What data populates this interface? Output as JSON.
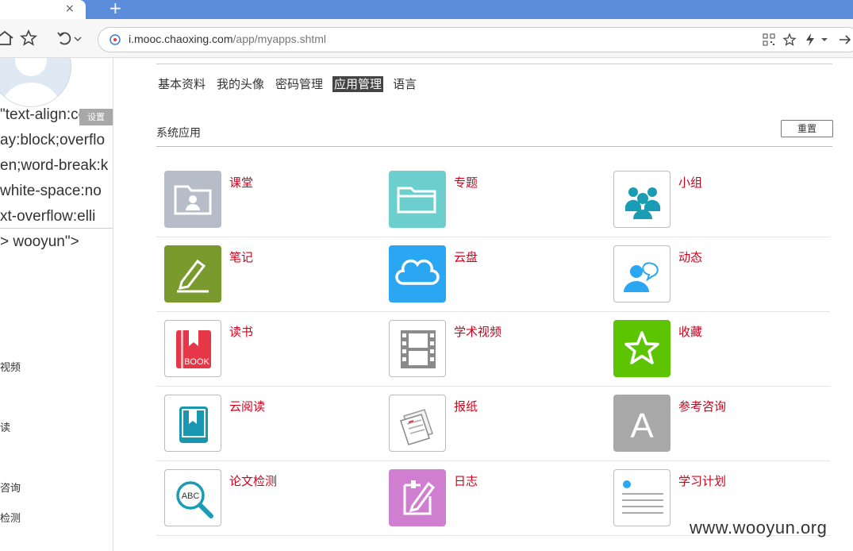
{
  "browser": {
    "tab_close": "×",
    "new_tab": "+",
    "url_host": "i.mooc.chaoxing.com",
    "url_path": "/app/myapps.shtml"
  },
  "left": {
    "set_label": "设置",
    "code_lines": [
      "\"text-align:cent",
      "ay:block;overflo",
      "en;word-break:k",
      "white-space:no",
      "xt-overflow:elli",
      "> wooyun\">"
    ],
    "side_items": [
      "视频",
      "读",
      "咨询",
      "检测"
    ]
  },
  "subnav": [
    "基本资料",
    "我的头像",
    "密码管理",
    "应用管理",
    "语言"
  ],
  "subnav_active": 3,
  "section": {
    "title": "系统应用",
    "reset_label": "重置"
  },
  "apps": [
    [
      {
        "name": "课堂",
        "icon": "classroom-icon"
      },
      {
        "name": "专题",
        "icon": "folder-icon"
      },
      {
        "name": "小组",
        "icon": "group-icon"
      }
    ],
    [
      {
        "name": "笔记",
        "icon": "note-pen-icon"
      },
      {
        "name": "云盘",
        "icon": "cloud-icon"
      },
      {
        "name": "动态",
        "icon": "chat-user-icon"
      }
    ],
    [
      {
        "name": "读书",
        "icon": "book-icon"
      },
      {
        "name": "学术视频",
        "icon": "film-icon"
      },
      {
        "name": "收藏",
        "icon": "star-icon"
      }
    ],
    [
      {
        "name": "云阅读",
        "icon": "ebook-icon"
      },
      {
        "name": "报纸",
        "icon": "newspaper-icon"
      },
      {
        "name": "参考咨询",
        "icon": "letter-a-icon"
      }
    ],
    [
      {
        "name": "论文检测",
        "icon": "abc-search-icon"
      },
      {
        "name": "日志",
        "icon": "diary-icon"
      },
      {
        "name": "学习计划",
        "icon": "plan-list-icon"
      }
    ]
  ],
  "icon_texts": {
    "book": "BOOK",
    "abc": "ABC",
    "letter_a": "A"
  },
  "colors": {
    "app_name": "#d0021b",
    "tabstrip": "#5b8ddb",
    "classroom": "#b6bdc9",
    "folder": "#6ccfce",
    "group": "#1a9cb4",
    "note": "#7a9a2e",
    "cloud": "#2aa6f2",
    "chat": "#2aa6f2",
    "book": "#e53747",
    "film": "#8a8a8a",
    "star": "#5cc400",
    "ebook": "#1a97b0",
    "letter": "#a8a8a8",
    "abc": "#1a9cb4",
    "diary": "#d07fd0",
    "plan": "#2aa6f2"
  },
  "watermark": "www.wooyun.org"
}
